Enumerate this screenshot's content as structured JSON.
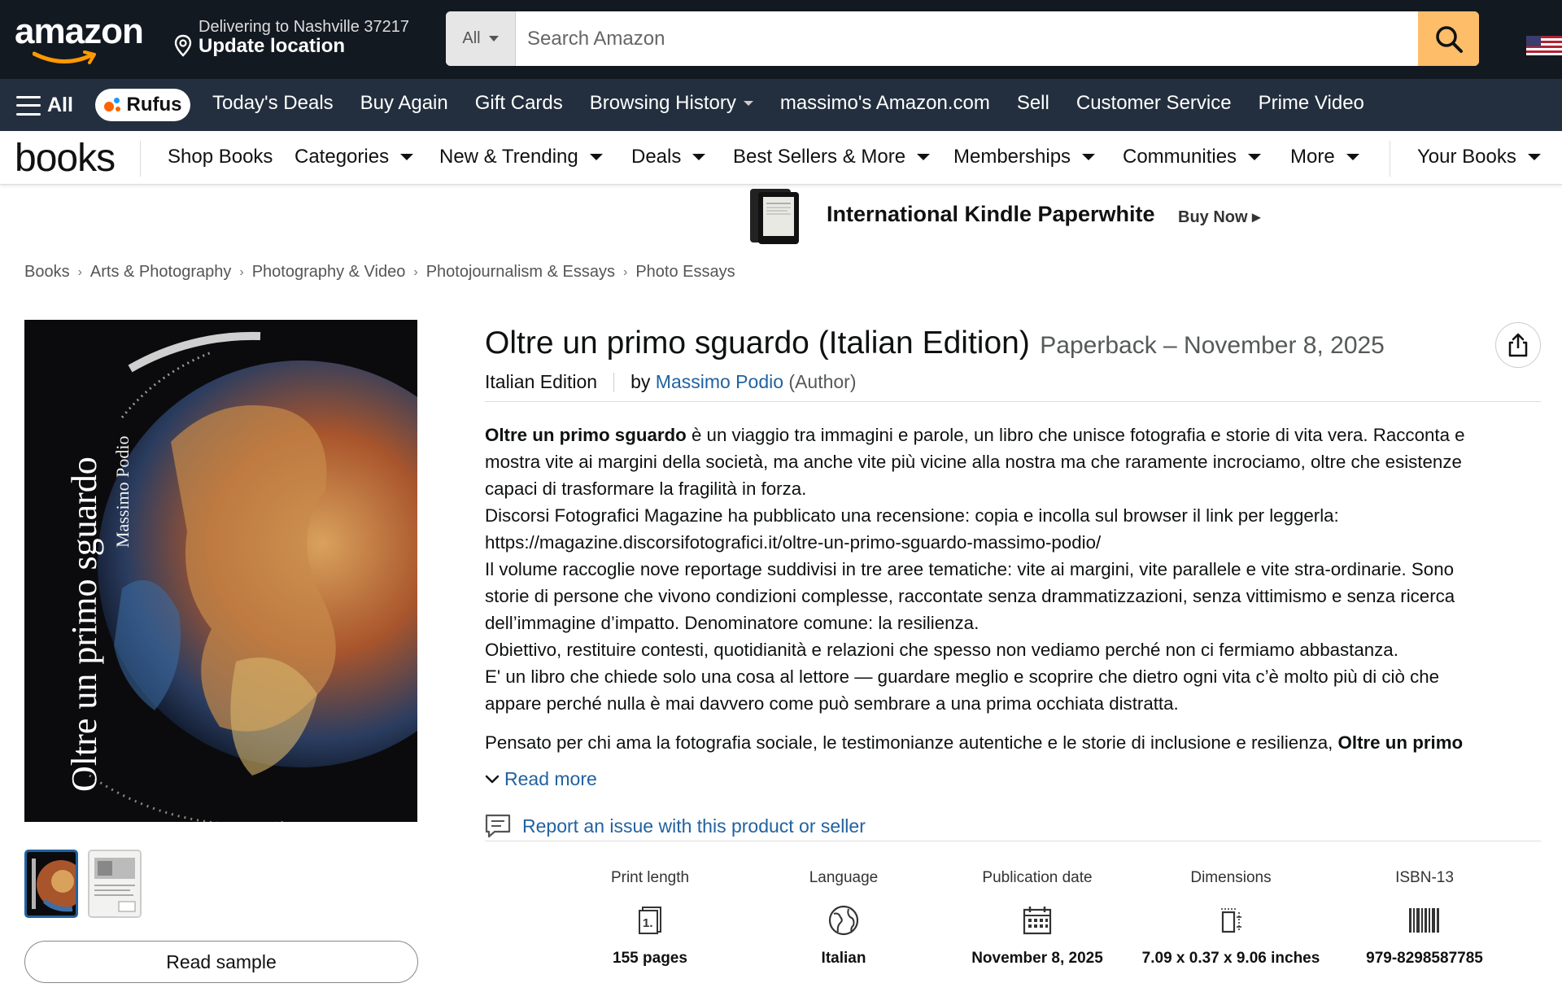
{
  "header": {
    "logo_text": "amazon",
    "deliver_line1": "Delivering to Nashville 37217",
    "deliver_line2": "Update location",
    "search_dept": "All",
    "search_placeholder": "Search Amazon",
    "flag": "us-flag-icon"
  },
  "subnav": {
    "all_label": "All",
    "rufus_label": "Rufus",
    "links": [
      "Today's Deals",
      "Buy Again",
      "Gift Cards",
      "Browsing History",
      "massimo's Amazon.com",
      "Sell",
      "Customer Service",
      "Prime Video"
    ]
  },
  "books_nav": {
    "logo": "books",
    "items": [
      "Shop Books",
      "Categories",
      "New & Trending",
      "Deals",
      "Best Sellers & More",
      "Memberships",
      "Communities",
      "More",
      "Your Books"
    ]
  },
  "banner": {
    "title": "International Kindle Paperwhite",
    "cta": "Buy Now ▸"
  },
  "breadcrumb": [
    "Books",
    "Arts & Photography",
    "Photography & Video",
    "Photojournalism & Essays",
    "Photo Essays"
  ],
  "cover": {
    "title_text": "Oltre un primo sguardo",
    "author_text": "Massimo Podio"
  },
  "read_sample": "Read sample",
  "product": {
    "title": "Oltre un primo sguardo (Italian Edition)",
    "format_date": "Paperback – November 8, 2025",
    "edition": "Italian Edition",
    "by": "by",
    "author": "Massimo Podio",
    "author_role": "(Author)"
  },
  "description": {
    "line1_bold": "Oltre un primo sguardo",
    "line1_rest": " è un viaggio tra immagini e parole, un libro che unisce fotografia e storie di vita vera. Racconta e",
    "line2": "mostra vite ai margini della società, ma anche vite più vicine alla nostra ma che raramente incrociamo, oltre che esistenze",
    "line3": "capaci di trasformare la fragilità in forza.",
    "line4": "Discorsi Fotografici Magazine ha pubblicato una recensione: copia e incolla sul browser il link per leggerla:",
    "line5": "https://magazine.discorsifotografici.it/oltre-un-primo-sguardo-massimo-podio/",
    "line6": "Il volume raccoglie nove reportage suddivisi in tre aree tematiche: vite ai margini, vite parallele e vite stra-ordinarie. Sono",
    "line7": "storie di persone che vivono condizioni complesse, raccontate senza drammatizzazioni, senza vittimismo e senza ricerca",
    "line8": "dell’immagine d’impatto. Denominatore comune: la resilienza.",
    "line9": "Obiettivo, restituire contesti, quotidianità e relazioni che spesso non vediamo perché non ci fermiamo abbastanza.",
    "line10": "E' un libro che chiede solo una cosa al lettore — guardare meglio e scoprire che dietro ogni vita c’è molto più di ciò che",
    "line11": "appare perché nulla è mai davvero come può sembrare a una prima occhiata distratta.",
    "line12_rest": "Pensato per chi ama la fotografia sociale, le testimonianze autentiche e le storie di inclusione e resilienza, ",
    "line12_bold": "Oltre un primo"
  },
  "read_more": "Read more",
  "report_issue": "Report an issue with this product or seller",
  "attributes": [
    {
      "label": "Print length",
      "icon": "page-count-icon",
      "value": "155 pages"
    },
    {
      "label": "Language",
      "icon": "globe-icon",
      "value": "Italian"
    },
    {
      "label": "Publication date",
      "icon": "calendar-icon",
      "value": "November 8, 2025"
    },
    {
      "label": "Dimensions",
      "icon": "dimensions-icon",
      "value": "7.09 x 0.37 x 9.06 inches"
    },
    {
      "label": "ISBN-13",
      "icon": "barcode-icon",
      "value": "979-8298587785"
    }
  ]
}
